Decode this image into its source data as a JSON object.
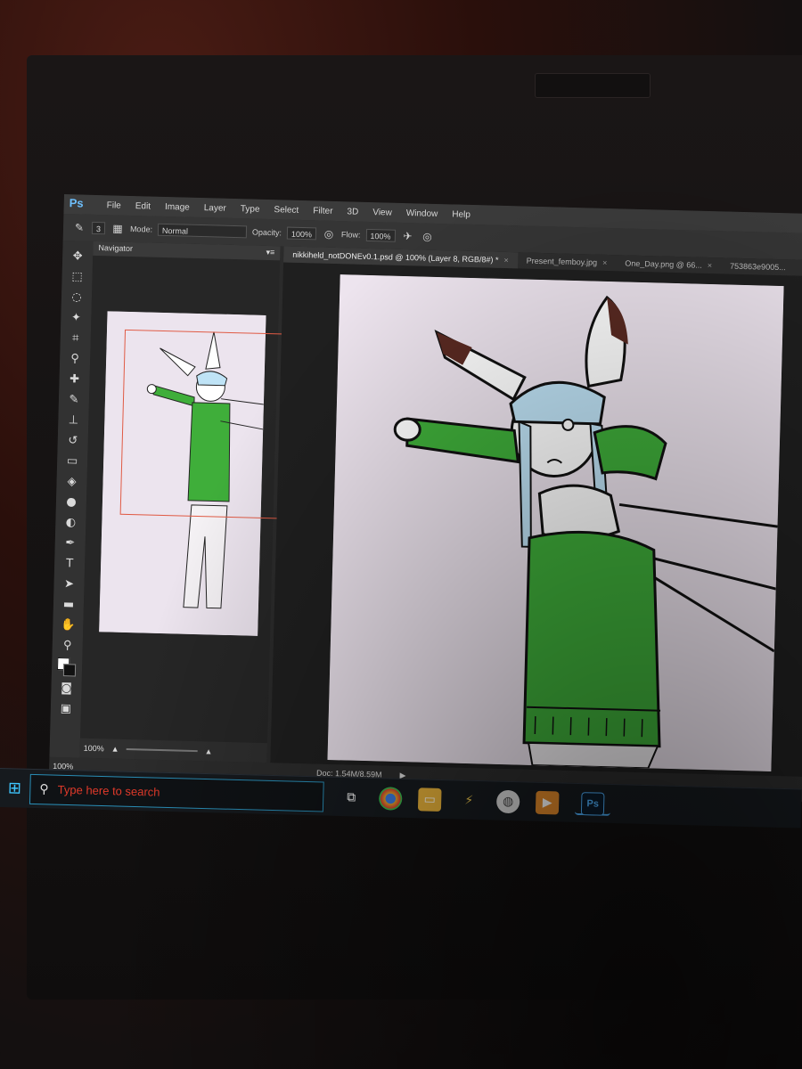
{
  "app": {
    "logo": "Ps",
    "menu": [
      "File",
      "Edit",
      "Image",
      "Layer",
      "Type",
      "Select",
      "Filter",
      "3D",
      "View",
      "Window",
      "Help"
    ]
  },
  "options_bar": {
    "brush_size": "3",
    "mode_label": "Mode:",
    "mode_value": "Normal",
    "opacity_label": "Opacity:",
    "opacity_value": "100%",
    "flow_label": "Flow:",
    "flow_value": "100%"
  },
  "navigator": {
    "title": "Navigator",
    "zoom": "100%"
  },
  "tabs": [
    {
      "label": "nikkiheld_notDONEv0.1.psd @ 100% (Layer 8, RGB/8#) *",
      "active": true
    },
    {
      "label": "Present_femboy.jpg",
      "active": false
    },
    {
      "label": "One_Day.png @ 66...",
      "active": false
    },
    {
      "label": "753863e9005...",
      "active": false
    }
  ],
  "status": {
    "zoom": "100%",
    "doc": "Doc: 1.54M/8.59M"
  },
  "taskbar": {
    "search_placeholder": "Type here to search",
    "icons": [
      "task-view-icon",
      "chrome-icon",
      "file-explorer-icon",
      "winamp-icon",
      "paint-icon",
      "media-player-icon",
      "photoshop-icon"
    ],
    "ps_label": "Ps"
  },
  "colors": {
    "sweater_green": "#3fae3a",
    "hair_blue": "#bfe3f6",
    "canvas_bg": "#ede4ee",
    "accent_red": "#e23a2a"
  }
}
